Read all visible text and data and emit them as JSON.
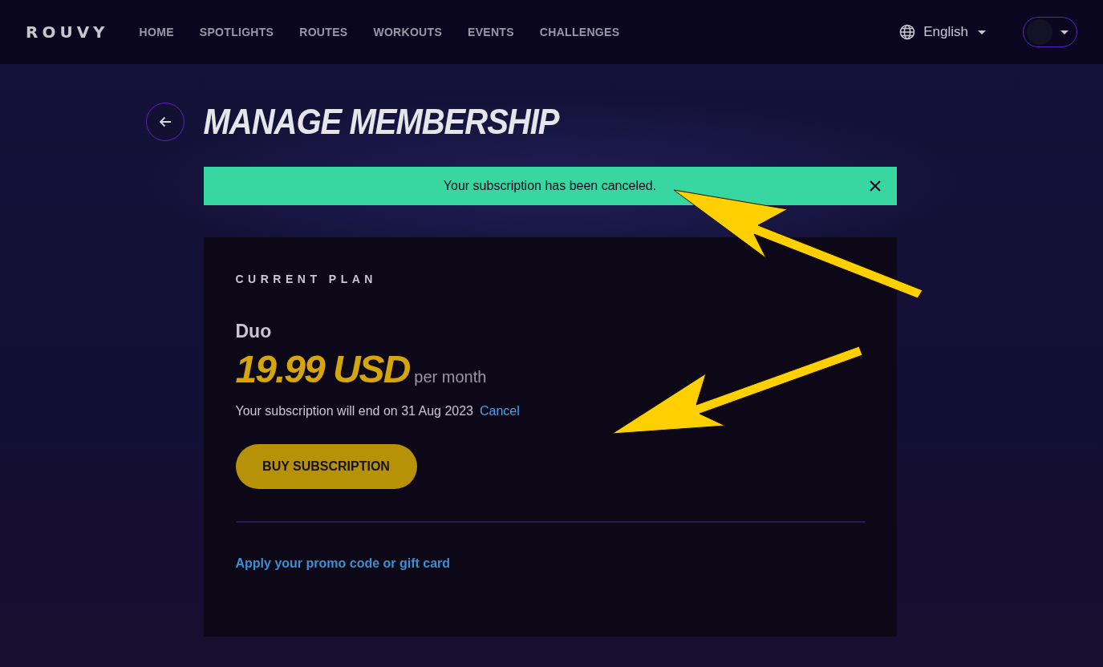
{
  "header": {
    "logo": "ROUVY",
    "nav": [
      {
        "label": "HOME",
        "selected": false
      },
      {
        "label": "SPOTLIGHTS",
        "selected": false
      },
      {
        "label": "ROUTES",
        "selected": false
      },
      {
        "label": "WORKOUTS",
        "selected": false
      },
      {
        "label": "EVENTS",
        "selected": false
      },
      {
        "label": "CHALLENGES",
        "selected": false
      }
    ],
    "language": "English"
  },
  "page": {
    "title": "MANAGE MEMBERSHIP"
  },
  "notice": {
    "message": "Your subscription has been canceled."
  },
  "plan": {
    "section_label": "CURRENT PLAN",
    "name": "Duo",
    "price": "19.99 USD",
    "period": "per month",
    "end_note": "Your subscription will end on 31 Aug 2023",
    "cancel_link": "Cancel",
    "buy_button": "BUY SUBSCRIPTION",
    "promo_link": "Apply your promo code or gift card"
  },
  "annotations": [
    {
      "kind": "arrow"
    },
    {
      "kind": "arrow"
    }
  ]
}
